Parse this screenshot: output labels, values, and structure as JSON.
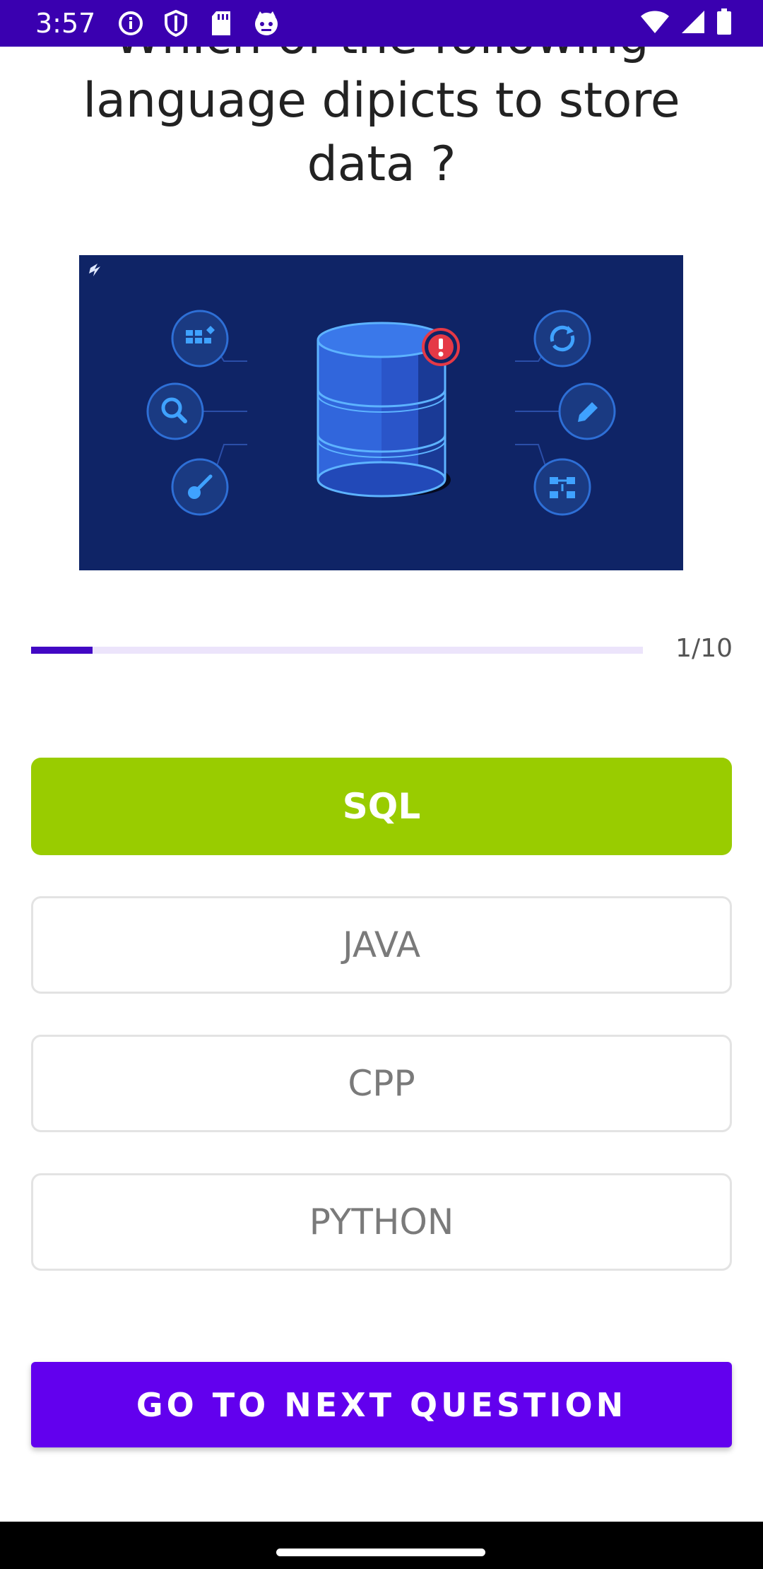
{
  "status_bar": {
    "time": "3:57",
    "icons": [
      "info-icon",
      "shield-icon",
      "sd-card-icon",
      "cat-face-icon",
      "wifi-icon",
      "signal-icon",
      "battery-icon"
    ],
    "background": "#3a00b0"
  },
  "question": {
    "text": "Which of the following language dipicts to store data ?"
  },
  "illustration": {
    "description_icons": [
      "grid-plus-icon",
      "search-icon",
      "key-icon",
      "database-icon",
      "alert-icon",
      "sync-icon",
      "edit-icon",
      "network-icon"
    ]
  },
  "progress": {
    "current": 1,
    "total": 10,
    "label": "1/10",
    "fraction": 0.1,
    "accent": "#4208c4"
  },
  "options": [
    {
      "label": "SQL",
      "state": "correct",
      "color": "#99cc00"
    },
    {
      "label": "JAVA",
      "state": "default"
    },
    {
      "label": "CPP",
      "state": "default"
    },
    {
      "label": "PYTHON",
      "state": "default"
    }
  ],
  "next_button": {
    "label": "GO TO NEXT QUESTION",
    "color": "#6200ee"
  }
}
